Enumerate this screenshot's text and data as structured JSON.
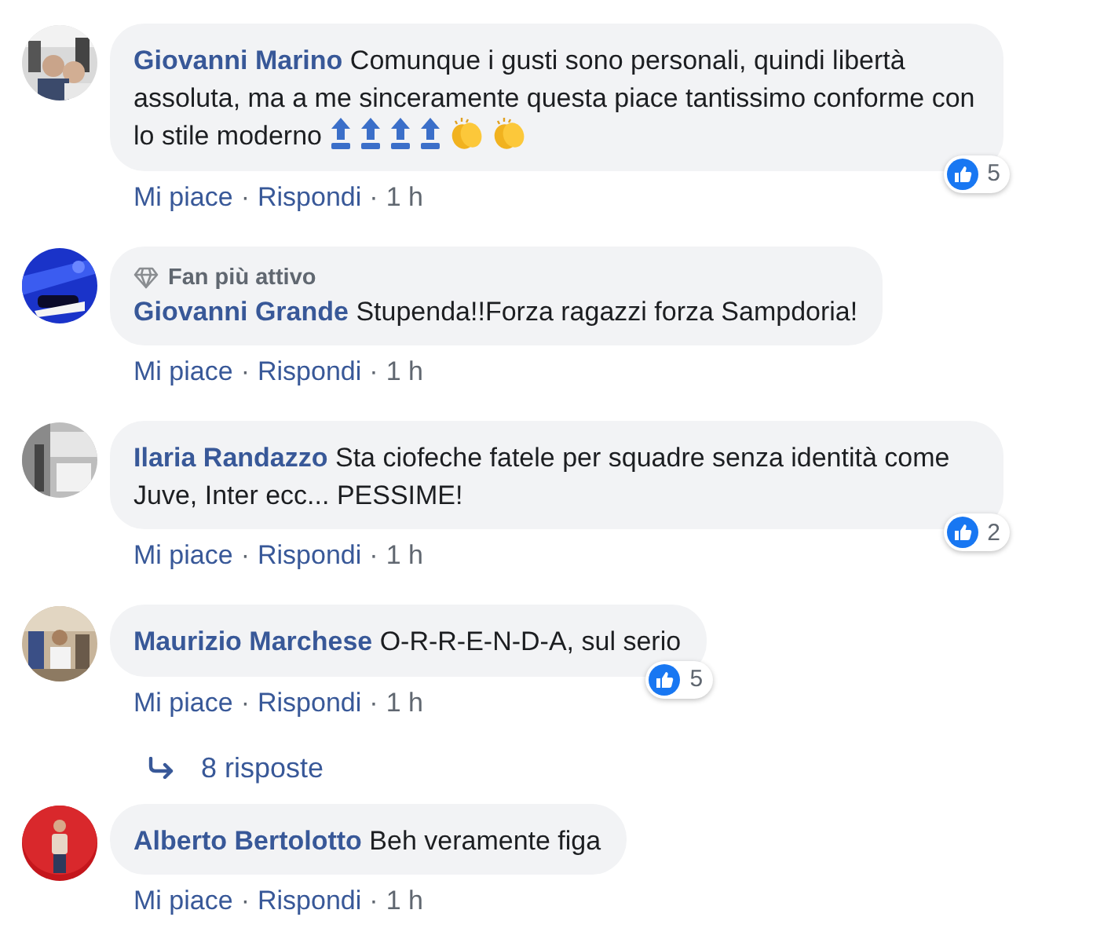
{
  "comments": [
    {
      "author": "Giovanni Marino",
      "text": "Comunque i gusti sono personali, quindi libertà assoluta, ma a me sinceramente questa piace tantissimo conforme con lo stile moderno",
      "trailing_icons": [
        {
          "kind": "top"
        },
        {
          "kind": "top"
        },
        {
          "kind": "top"
        },
        {
          "kind": "top"
        },
        {
          "kind": "clap"
        },
        {
          "kind": "clap"
        }
      ],
      "reaction_count": "5",
      "actions": [
        {
          "kind": "link",
          "text": "Mi piace"
        },
        {
          "kind": "separator",
          "text": "·"
        },
        {
          "kind": "link",
          "text": "Rispondi"
        },
        {
          "kind": "separator",
          "text": "·"
        },
        {
          "kind": "time",
          "text": "1 h"
        }
      ]
    },
    {
      "badge": "Fan più attivo",
      "author": "Giovanni Grande",
      "text": "Stupenda!!Forza ragazzi forza Sampdoria!",
      "actions": [
        {
          "kind": "link",
          "text": "Mi piace"
        },
        {
          "kind": "separator",
          "text": "·"
        },
        {
          "kind": "link",
          "text": "Rispondi"
        },
        {
          "kind": "separator",
          "text": "·"
        },
        {
          "kind": "time",
          "text": "1 h"
        }
      ]
    },
    {
      "author": "Ilaria Randazzo",
      "text": "Sta ciofeche fatele per squadre senza identità come Juve, Inter ecc... PESSIME!",
      "reaction_count": "2",
      "actions": [
        {
          "kind": "link",
          "text": "Mi piace"
        },
        {
          "kind": "separator",
          "text": "·"
        },
        {
          "kind": "link",
          "text": "Rispondi"
        },
        {
          "kind": "separator",
          "text": "·"
        },
        {
          "kind": "time",
          "text": "1 h"
        }
      ]
    },
    {
      "author": "Maurizio Marchese",
      "text": "O-R-R-E-N-D-A, sul serio",
      "reaction_count": "5",
      "actions": [
        {
          "kind": "link",
          "text": "Mi piace"
        },
        {
          "kind": "separator",
          "text": "·"
        },
        {
          "kind": "link",
          "text": "Rispondi"
        },
        {
          "kind": "separator",
          "text": "·"
        },
        {
          "kind": "time",
          "text": "1 h"
        }
      ],
      "replies_link": "8 risposte"
    },
    {
      "author": "Alberto Bertolotto",
      "text": "Beh veramente figa",
      "actions": [
        {
          "kind": "link",
          "text": "Mi piace"
        },
        {
          "kind": "separator",
          "text": "·"
        },
        {
          "kind": "link",
          "text": "Rispondi"
        },
        {
          "kind": "separator",
          "text": "·"
        },
        {
          "kind": "time",
          "text": "1 h"
        }
      ]
    }
  ]
}
